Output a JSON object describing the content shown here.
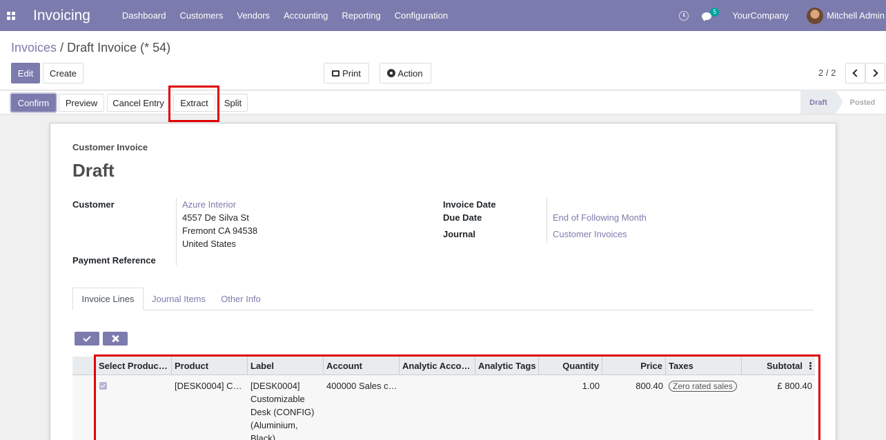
{
  "navbar": {
    "app_name": "Invoicing",
    "menu": [
      "Dashboard",
      "Customers",
      "Vendors",
      "Accounting",
      "Reporting",
      "Configuration"
    ],
    "chat_count": "5",
    "company": "YourCompany",
    "user": "Mitchell Admin"
  },
  "breadcrumb": {
    "parent": "Invoices",
    "separator": "/",
    "current": "Draft Invoice (* 54)"
  },
  "buttons": {
    "edit": "Edit",
    "create": "Create",
    "print": "Print",
    "action": "Action"
  },
  "pager": {
    "value": "2 / 2"
  },
  "status_buttons": {
    "confirm": "Confirm",
    "preview": "Preview",
    "cancel_entry": "Cancel Entry",
    "extract": "Extract",
    "split": "Split"
  },
  "stages": {
    "draft": "Draft",
    "posted": "Posted"
  },
  "form": {
    "doc_type": "Customer Invoice",
    "state": "Draft",
    "customer_label": "Customer",
    "customer_name": "Azure Interior",
    "address": [
      "4557 De Silva St",
      "Fremont CA 94538",
      "United States"
    ],
    "payment_ref_label": "Payment Reference",
    "invoice_date_label": "Invoice Date",
    "due_date_label": "Due Date",
    "due_date_value": "End of Following Month",
    "journal_label": "Journal",
    "journal_value": "Customer Invoices"
  },
  "tabs": [
    "Invoice Lines",
    "Journal Items",
    "Other Info"
  ],
  "table": {
    "headers": [
      "Select Produc…",
      "Product",
      "Label",
      "Account",
      "Analytic Acco…",
      "Analytic Tags",
      "Quantity",
      "Price",
      "Taxes",
      "Subtotal"
    ],
    "rows": [
      {
        "selected": true,
        "product": "[DESK0004] C…",
        "label_lines": [
          "[DESK0004]",
          "Customizable",
          "Desk (CONFIG)",
          "(Aluminium,",
          "Black)"
        ],
        "account": "400000 Sales c…",
        "analytic_account": "",
        "analytic_tags": "",
        "quantity": "1.00",
        "price": "800.40",
        "tax": "Zero rated sales",
        "subtotal": "£ 800.40"
      }
    ]
  }
}
